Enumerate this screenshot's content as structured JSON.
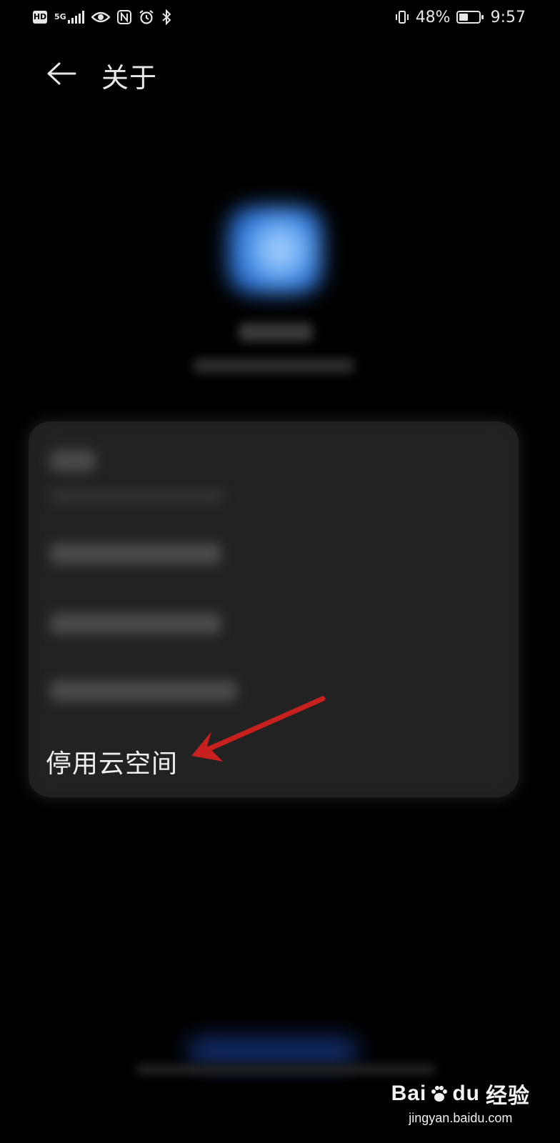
{
  "status_bar": {
    "left_icons": [
      "hd-icon",
      "5g-signal-icon",
      "eye-comfort-icon",
      "nfc-icon",
      "alarm-icon",
      "bluetooth-icon"
    ],
    "hd_label": "HD",
    "network_label": "5G",
    "battery_percent": "48%",
    "battery_level": 0.48,
    "time": "9:57"
  },
  "header": {
    "title": "关于"
  },
  "menu": {
    "disable_label": "停用云空间"
  },
  "annotation": {
    "arrow_color": "#c8201e"
  },
  "watermark": {
    "brand": "Bai",
    "brand_suffix": "du",
    "brand_cn": "经验",
    "url": "jingyan.baidu.com"
  },
  "colors": {
    "background": "#000000",
    "card": "#1f1f1f",
    "accent_blue": "#6fb0f4"
  }
}
